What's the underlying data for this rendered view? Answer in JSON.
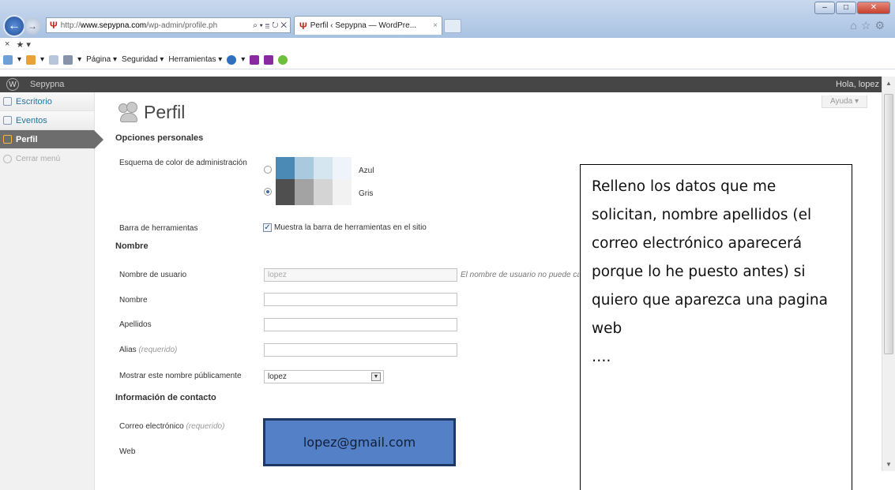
{
  "browser": {
    "url_domain": "www.sepypna.com",
    "url_prefix": "http://",
    "url_path": "/wp-admin/profile.ph",
    "url_controls": "⌕ ▾ ≣ ↻ ✕",
    "tab_title": "Perfil ‹ Sepypna — WordPre...",
    "tab_close": "×",
    "menu_items": [
      "Página ▾",
      "Seguridad ▾",
      "Herramientas ▾"
    ]
  },
  "wp": {
    "site_name": "Sepypna",
    "greeting": "Hola, lopez",
    "help": "Ayuda ▾"
  },
  "sidebar": {
    "items": [
      {
        "label": "Escritorio"
      },
      {
        "label": "Eventos"
      },
      {
        "label": "Perfil"
      },
      {
        "label": "Cerrar menú"
      }
    ]
  },
  "page": {
    "title": "Perfil",
    "sec_personal": "Opciones personales",
    "color_scheme_label": "Esquema de color de administración",
    "scheme_blue": "Azul",
    "scheme_gray": "Gris",
    "toolbar_label": "Barra de herramientas",
    "toolbar_checkbox": "Muestra la barra de herramientas en el sitio",
    "sec_name": "Nombre",
    "username_label": "Nombre de usuario",
    "username_value": "lopez",
    "username_note": "El nombre de usuario no puede ca",
    "firstname_label": "Nombre",
    "lastname_label": "Apellidos",
    "alias_label": "Alias",
    "required_hint": "(requerido)",
    "display_label": "Mostrar este nombre públicamente",
    "display_value": "lopez",
    "sec_contact": "Información de contacto",
    "email_label": "Correo electrónico",
    "web_label": "Web"
  },
  "colors": {
    "scheme_blue": [
      "#4a8ab5",
      "#a9c9df",
      "#d5e6f1",
      "#eef4f9"
    ],
    "scheme_gray": [
      "#4f4f4f",
      "#a3a3a3",
      "#d4d4d4",
      "#f2f2f2"
    ]
  },
  "annotation": {
    "callout_text": "Relleno los datos que me solicitan, nombre apellidos (el correo electrónico aparecerá porque lo he puesto antes) si quiero que aparezca una pagina web \n….",
    "email_overlay": "lopez@gmail.com"
  }
}
